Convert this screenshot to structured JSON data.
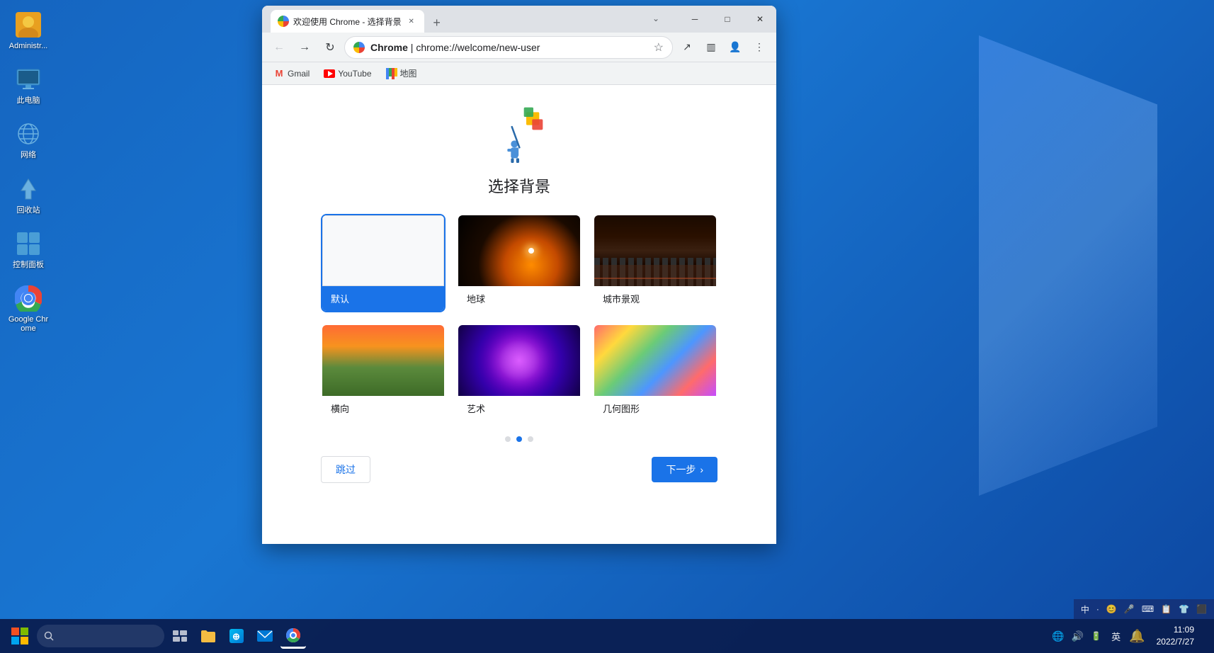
{
  "desktop": {
    "icons": [
      {
        "id": "admin",
        "label": "Administr...",
        "emoji": "👤"
      },
      {
        "id": "computer",
        "label": "此电脑",
        "emoji": "🖥"
      },
      {
        "id": "network",
        "label": "网络",
        "emoji": "🌐"
      },
      {
        "id": "recycle",
        "label": "回收站",
        "emoji": "🗑"
      },
      {
        "id": "control",
        "label": "控制面板",
        "emoji": "⚙"
      },
      {
        "id": "chrome",
        "label": "Google Chrome",
        "emoji": "🔵"
      }
    ]
  },
  "browser": {
    "tab_title": "欢迎使用 Chrome - 选择背景",
    "tab_favicon": "chrome",
    "url_site": "Chrome",
    "url_full": "chrome://welcome/new-user",
    "url_display_prefix": "Chrome",
    "url_display_url": " | chrome://welcome/new-user",
    "bookmarks": [
      {
        "id": "gmail",
        "label": "Gmail",
        "icon": "M"
      },
      {
        "id": "youtube",
        "label": "YouTube",
        "icon": "▶"
      },
      {
        "id": "maps",
        "label": "地图",
        "icon": "📍"
      }
    ]
  },
  "page": {
    "title": "选择背景",
    "backgrounds": [
      {
        "id": "default",
        "label": "默认",
        "selected": true,
        "thumb": "default"
      },
      {
        "id": "earth",
        "label": "地球",
        "selected": false,
        "thumb": "earth"
      },
      {
        "id": "city",
        "label": "城市景观",
        "selected": false,
        "thumb": "city"
      },
      {
        "id": "landscape",
        "label": "横向",
        "selected": false,
        "thumb": "landscape"
      },
      {
        "id": "art",
        "label": "艺术",
        "selected": false,
        "thumb": "art"
      },
      {
        "id": "geo",
        "label": "几何图形",
        "selected": false,
        "thumb": "geo"
      }
    ],
    "pagination": {
      "current": 1,
      "total": 3
    },
    "btn_skip": "跳过",
    "btn_next": "下一步"
  },
  "taskbar": {
    "time": "11:09",
    "date": "2022/7/27",
    "icons": [
      {
        "id": "start",
        "label": "Start"
      },
      {
        "id": "search",
        "label": "Search"
      },
      {
        "id": "task-view",
        "label": "Task View"
      },
      {
        "id": "file-explorer",
        "label": "File Explorer"
      },
      {
        "id": "store",
        "label": "Microsoft Store"
      },
      {
        "id": "mail",
        "label": "Mail"
      },
      {
        "id": "chrome-taskbar",
        "label": "Google Chrome"
      }
    ],
    "ime": {
      "label": "中",
      "items": [
        "中",
        "·",
        "😊",
        "🎤",
        "⌨",
        "📋",
        "👕",
        "⬛"
      ]
    }
  }
}
